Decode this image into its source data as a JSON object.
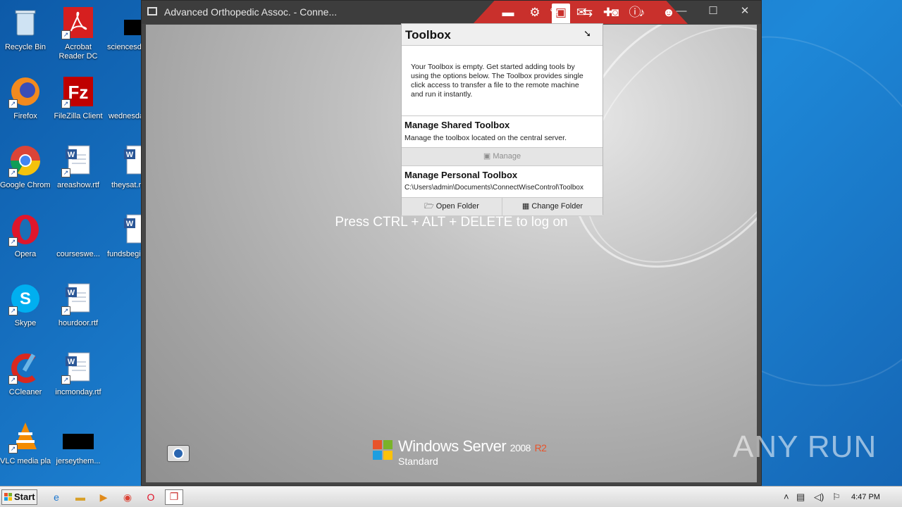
{
  "desktop": {
    "icons": [
      {
        "label": "Recycle Bin"
      },
      {
        "label": "Acrobat Reader DC"
      },
      {
        "label": "sciencesda..."
      },
      {
        "label": "Firefox"
      },
      {
        "label": "FileZilla Client"
      },
      {
        "label": "wednesda..."
      },
      {
        "label": "Google Chrome"
      },
      {
        "label": "areashow.rtf"
      },
      {
        "label": "theysat.rtf"
      },
      {
        "label": "Opera"
      },
      {
        "label": "courseswe..."
      },
      {
        "label": "fundsbegi..."
      },
      {
        "label": "Skype"
      },
      {
        "label": "hourdoor.rtf"
      },
      {
        "label": "CCleaner"
      },
      {
        "label": "incmonday.rtf"
      },
      {
        "label": "VLC media player"
      },
      {
        "label": "jerseythem..."
      }
    ]
  },
  "remote_window": {
    "title": "Advanced Orthopedic Assoc. - Conne...",
    "controls": {
      "minimize": "—",
      "maximize": "☐",
      "close": "✕"
    }
  },
  "toolbar": {
    "buttons": [
      "display",
      "gear",
      "toolbox",
      "transfer",
      "camera",
      "microphone",
      "users",
      "pen",
      "chat",
      "plus",
      "info"
    ]
  },
  "remote_screen": {
    "prompt": "Press CTRL + ALT + DELETE to log on",
    "os_brand": "Windows Server",
    "os_version": "2008",
    "os_release": "R2",
    "os_edition": "Standard"
  },
  "toolbox": {
    "title": "Toolbox",
    "empty_message": "Your Toolbox is empty. Get started adding tools by using the options below. The Toolbox provides single click access to transfer a file to the remote machine and run it instantly.",
    "shared": {
      "title": "Manage Shared Toolbox",
      "description": "Manage the toolbox located on the central server.",
      "button": "Manage"
    },
    "personal": {
      "title": "Manage Personal Toolbox",
      "path": "C:\\Users\\admin\\Documents\\ConnectWiseControl\\Toolbox",
      "open_button": "Open Folder",
      "change_button": "Change Folder"
    }
  },
  "watermark": "ANY RUN",
  "taskbar": {
    "start_label": "Start",
    "apps": [
      "internet-explorer",
      "explorer",
      "media-player",
      "chrome",
      "opera",
      "connectwise"
    ],
    "clock": "4:47 PM"
  }
}
